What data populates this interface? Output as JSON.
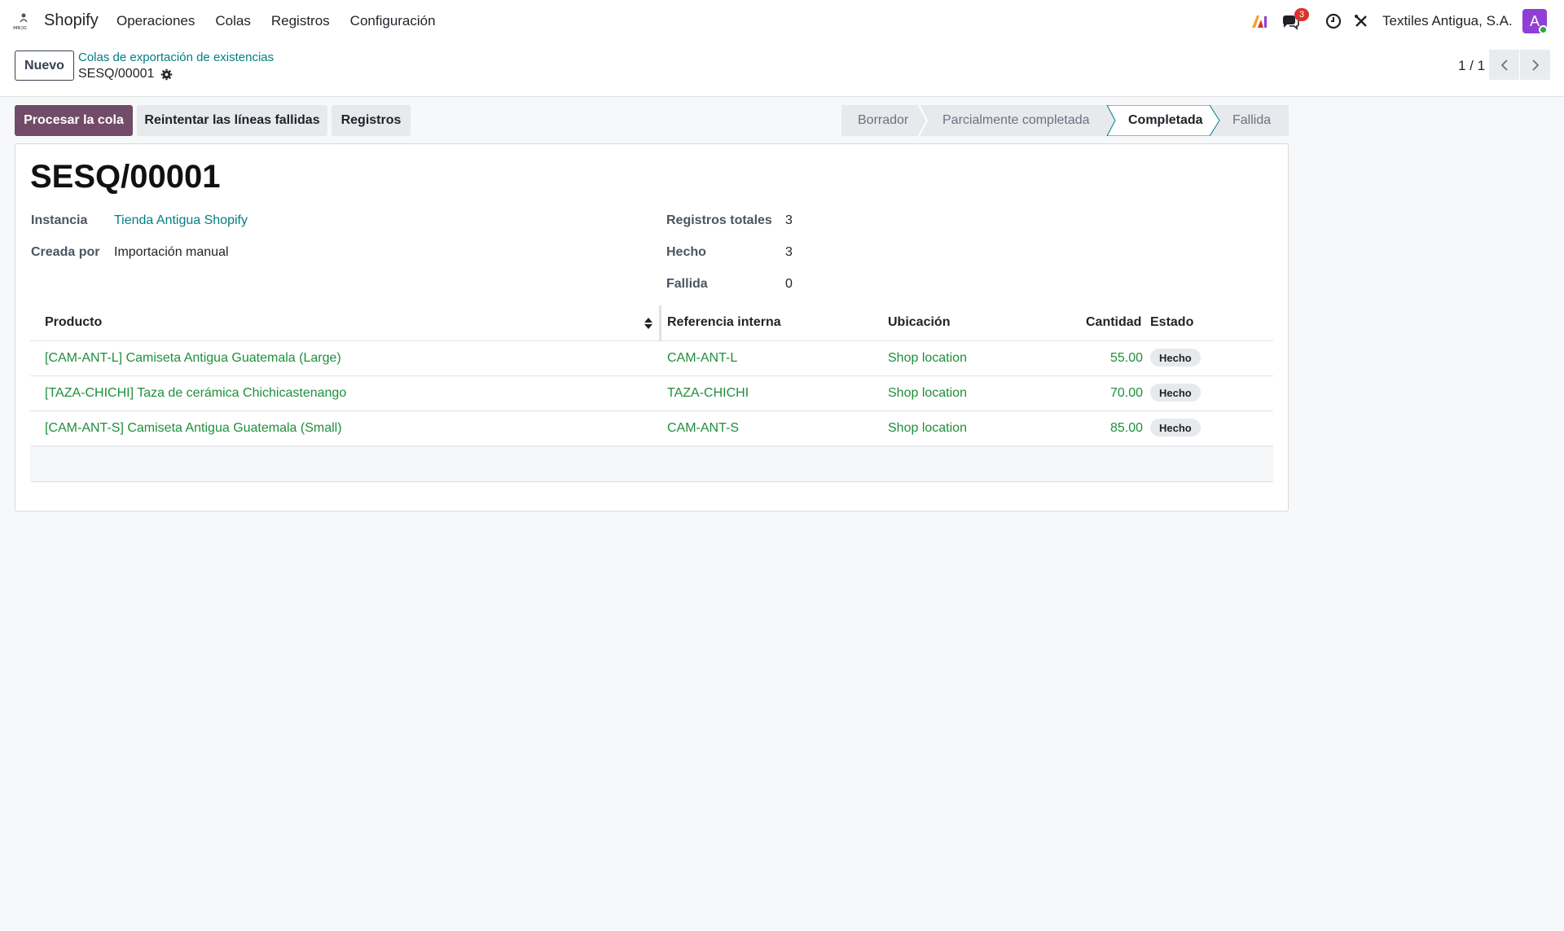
{
  "navbar": {
    "app_name": "Shopify",
    "menu": [
      "Operaciones",
      "Colas",
      "Registros",
      "Configuración"
    ],
    "messages_count": "3",
    "company": "Textiles Antigua, S.A.",
    "avatar_letter": "A"
  },
  "control": {
    "new_label": "Nuevo",
    "breadcrumb_parent": "Colas de exportación de existencias",
    "breadcrumb_current": "SESQ/00001",
    "pager": "1 / 1"
  },
  "actions": {
    "process": "Procesar la cola",
    "retry": "Reintentar las líneas fallidas",
    "logs": "Registros"
  },
  "statusbar": {
    "stages": [
      "Borrador",
      "Parcialmente completada",
      "Completada",
      "Fallida"
    ],
    "active": "Completada"
  },
  "record": {
    "title": "SESQ/00001",
    "instance_label": "Instancia",
    "instance_value": "Tienda Antigua Shopify",
    "created_label": "Creada por",
    "created_value": "Importación manual",
    "total_label": "Registros totales",
    "total_value": "3",
    "done_label": "Hecho",
    "done_value": "3",
    "failed_label": "Fallida",
    "failed_value": "0"
  },
  "table": {
    "headers": [
      "Producto",
      "Referencia interna",
      "Ubicación",
      "Cantidad",
      "Estado"
    ],
    "rows": [
      {
        "product": "[CAM-ANT-L] Camiseta Antigua Guatemala (Large)",
        "ref": "CAM-ANT-L",
        "location": "Shop location",
        "qty": "55.00",
        "state": "Hecho"
      },
      {
        "product": "[TAZA-CHICHI] Taza de cerámica Chichicastenango",
        "ref": "TAZA-CHICHI",
        "location": "Shop location",
        "qty": "70.00",
        "state": "Hecho"
      },
      {
        "product": "[CAM-ANT-S] Camiseta Antigua Guatemala (Small)",
        "ref": "CAM-ANT-S",
        "location": "Shop location",
        "qty": "85.00",
        "state": "Hecho"
      }
    ]
  },
  "colors": {
    "primary": "#714b67",
    "link": "#017e84",
    "row_link": "#1f8f3a"
  }
}
